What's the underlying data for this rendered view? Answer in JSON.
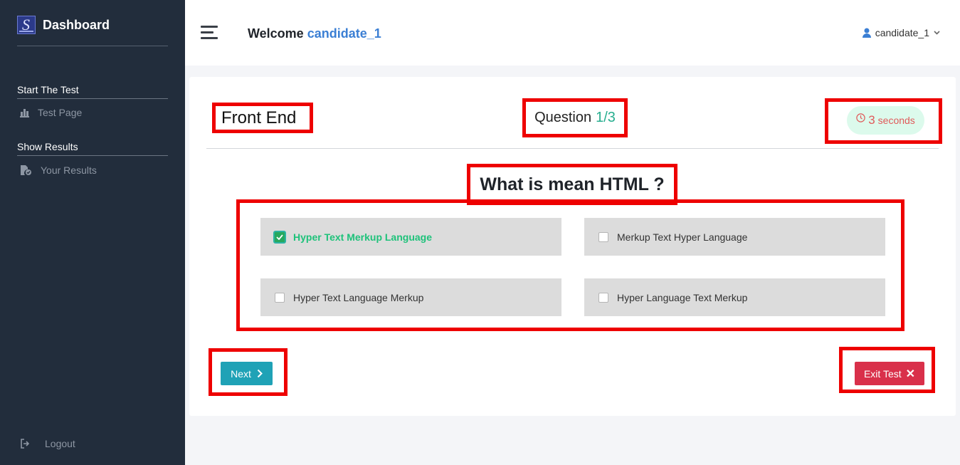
{
  "sidebar": {
    "brand_title": "Dashboard",
    "sections": [
      {
        "title": "Start The Test",
        "item_label": "Test Page",
        "item_icon": "bar-chart-icon"
      },
      {
        "title": "Show Results",
        "item_label": "Your Results",
        "item_icon": "file-check-icon"
      }
    ],
    "logout_label": "Logout"
  },
  "topbar": {
    "welcome_prefix": "Welcome",
    "welcome_user": "candidate_1",
    "user_menu_label": "candidate_1"
  },
  "test": {
    "category": "Front End",
    "question_label": "Question",
    "question_progress": "1/3",
    "timer_value": "3",
    "timer_unit": "seconds",
    "question_text": "What is mean HTML ?",
    "options": [
      {
        "label": "Hyper Text Merkup Language",
        "checked": true
      },
      {
        "label": "Merkup Text Hyper Language",
        "checked": false
      },
      {
        "label": "Hyper Text Language Merkup",
        "checked": false
      },
      {
        "label": "Hyper Language Text Merkup",
        "checked": false
      }
    ],
    "next_label": "Next",
    "exit_label": "Exit Test",
    "exit_icon": "✕"
  },
  "colors": {
    "sidebar_bg": "#222d3c",
    "accent_blue": "#3b7fd4",
    "progress_green": "#27ae8f",
    "selected_green": "#1ec27a",
    "next_teal": "#1fa2b6",
    "exit_red": "#d9304a",
    "annotation_red": "#ee0000",
    "timer_bg": "#dcfaec"
  }
}
